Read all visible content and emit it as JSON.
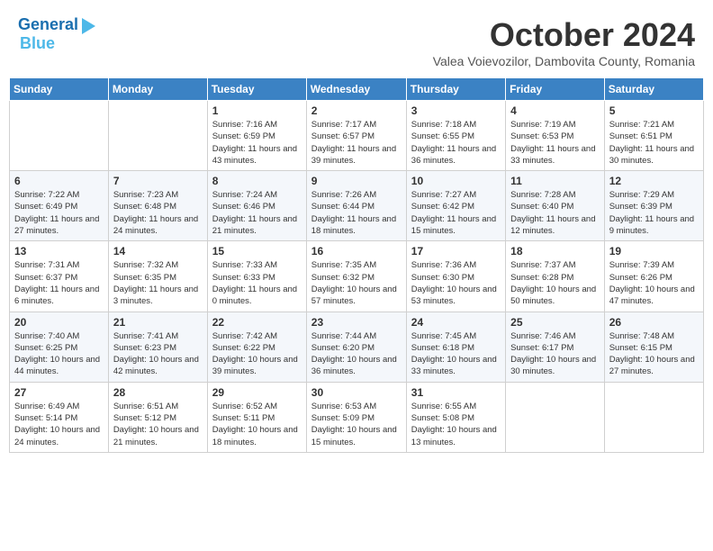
{
  "header": {
    "logo_line1": "General",
    "logo_line2": "Blue",
    "month_title": "October 2024",
    "location": "Valea Voievozilor, Dambovita County, Romania"
  },
  "days_of_week": [
    "Sunday",
    "Monday",
    "Tuesday",
    "Wednesday",
    "Thursday",
    "Friday",
    "Saturday"
  ],
  "weeks": [
    [
      null,
      null,
      {
        "day": 1,
        "sunrise": "7:16 AM",
        "sunset": "6:59 PM",
        "daylight": "11 hours and 43 minutes."
      },
      {
        "day": 2,
        "sunrise": "7:17 AM",
        "sunset": "6:57 PM",
        "daylight": "11 hours and 39 minutes."
      },
      {
        "day": 3,
        "sunrise": "7:18 AM",
        "sunset": "6:55 PM",
        "daylight": "11 hours and 36 minutes."
      },
      {
        "day": 4,
        "sunrise": "7:19 AM",
        "sunset": "6:53 PM",
        "daylight": "11 hours and 33 minutes."
      },
      {
        "day": 5,
        "sunrise": "7:21 AM",
        "sunset": "6:51 PM",
        "daylight": "11 hours and 30 minutes."
      }
    ],
    [
      {
        "day": 6,
        "sunrise": "7:22 AM",
        "sunset": "6:49 PM",
        "daylight": "11 hours and 27 minutes."
      },
      {
        "day": 7,
        "sunrise": "7:23 AM",
        "sunset": "6:48 PM",
        "daylight": "11 hours and 24 minutes."
      },
      {
        "day": 8,
        "sunrise": "7:24 AM",
        "sunset": "6:46 PM",
        "daylight": "11 hours and 21 minutes."
      },
      {
        "day": 9,
        "sunrise": "7:26 AM",
        "sunset": "6:44 PM",
        "daylight": "11 hours and 18 minutes."
      },
      {
        "day": 10,
        "sunrise": "7:27 AM",
        "sunset": "6:42 PM",
        "daylight": "11 hours and 15 minutes."
      },
      {
        "day": 11,
        "sunrise": "7:28 AM",
        "sunset": "6:40 PM",
        "daylight": "11 hours and 12 minutes."
      },
      {
        "day": 12,
        "sunrise": "7:29 AM",
        "sunset": "6:39 PM",
        "daylight": "11 hours and 9 minutes."
      }
    ],
    [
      {
        "day": 13,
        "sunrise": "7:31 AM",
        "sunset": "6:37 PM",
        "daylight": "11 hours and 6 minutes."
      },
      {
        "day": 14,
        "sunrise": "7:32 AM",
        "sunset": "6:35 PM",
        "daylight": "11 hours and 3 minutes."
      },
      {
        "day": 15,
        "sunrise": "7:33 AM",
        "sunset": "6:33 PM",
        "daylight": "11 hours and 0 minutes."
      },
      {
        "day": 16,
        "sunrise": "7:35 AM",
        "sunset": "6:32 PM",
        "daylight": "10 hours and 57 minutes."
      },
      {
        "day": 17,
        "sunrise": "7:36 AM",
        "sunset": "6:30 PM",
        "daylight": "10 hours and 53 minutes."
      },
      {
        "day": 18,
        "sunrise": "7:37 AM",
        "sunset": "6:28 PM",
        "daylight": "10 hours and 50 minutes."
      },
      {
        "day": 19,
        "sunrise": "7:39 AM",
        "sunset": "6:26 PM",
        "daylight": "10 hours and 47 minutes."
      }
    ],
    [
      {
        "day": 20,
        "sunrise": "7:40 AM",
        "sunset": "6:25 PM",
        "daylight": "10 hours and 44 minutes."
      },
      {
        "day": 21,
        "sunrise": "7:41 AM",
        "sunset": "6:23 PM",
        "daylight": "10 hours and 42 minutes."
      },
      {
        "day": 22,
        "sunrise": "7:42 AM",
        "sunset": "6:22 PM",
        "daylight": "10 hours and 39 minutes."
      },
      {
        "day": 23,
        "sunrise": "7:44 AM",
        "sunset": "6:20 PM",
        "daylight": "10 hours and 36 minutes."
      },
      {
        "day": 24,
        "sunrise": "7:45 AM",
        "sunset": "6:18 PM",
        "daylight": "10 hours and 33 minutes."
      },
      {
        "day": 25,
        "sunrise": "7:46 AM",
        "sunset": "6:17 PM",
        "daylight": "10 hours and 30 minutes."
      },
      {
        "day": 26,
        "sunrise": "7:48 AM",
        "sunset": "6:15 PM",
        "daylight": "10 hours and 27 minutes."
      }
    ],
    [
      {
        "day": 27,
        "sunrise": "6:49 AM",
        "sunset": "5:14 PM",
        "daylight": "10 hours and 24 minutes."
      },
      {
        "day": 28,
        "sunrise": "6:51 AM",
        "sunset": "5:12 PM",
        "daylight": "10 hours and 21 minutes."
      },
      {
        "day": 29,
        "sunrise": "6:52 AM",
        "sunset": "5:11 PM",
        "daylight": "10 hours and 18 minutes."
      },
      {
        "day": 30,
        "sunrise": "6:53 AM",
        "sunset": "5:09 PM",
        "daylight": "10 hours and 15 minutes."
      },
      {
        "day": 31,
        "sunrise": "6:55 AM",
        "sunset": "5:08 PM",
        "daylight": "10 hours and 13 minutes."
      },
      null,
      null
    ]
  ]
}
